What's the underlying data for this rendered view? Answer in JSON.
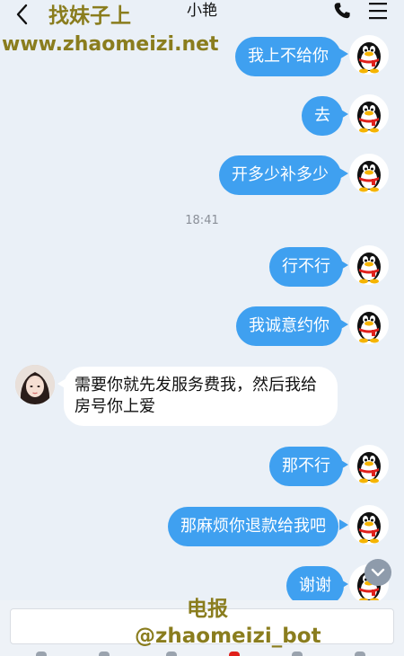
{
  "header": {
    "contact_name": "小艳",
    "back_icon": "chevron-left-icon",
    "call_icon": "phone-icon",
    "menu_icon": "menu-icon"
  },
  "watermark": {
    "title": "找妹子上",
    "url": "www.zhaomeizi.net",
    "tg_label": "电报",
    "tg_handle": "@zhaomeizi_bot"
  },
  "messages": [
    {
      "side": "out",
      "text": "我上不给你"
    },
    {
      "side": "out",
      "text": "去"
    },
    {
      "side": "out",
      "text": "开多少补多少"
    },
    {
      "side": "out",
      "text": "行不行"
    },
    {
      "side": "out",
      "text": "我诚意约你"
    },
    {
      "side": "in",
      "text": "需要你就先发服务费我，然后我给房号你上爱"
    },
    {
      "side": "out",
      "text": "那不行"
    },
    {
      "side": "out",
      "text": "那麻烦你退款给我吧"
    },
    {
      "side": "out",
      "text": "谢谢"
    }
  ],
  "timestamp": "18:41",
  "colors": {
    "outgoing_bubble": "#3fa0f0",
    "incoming_bubble": "#ffffff",
    "background": "#eaf0f7",
    "watermark": "#8a7d1e"
  },
  "input": {
    "placeholder": ""
  }
}
